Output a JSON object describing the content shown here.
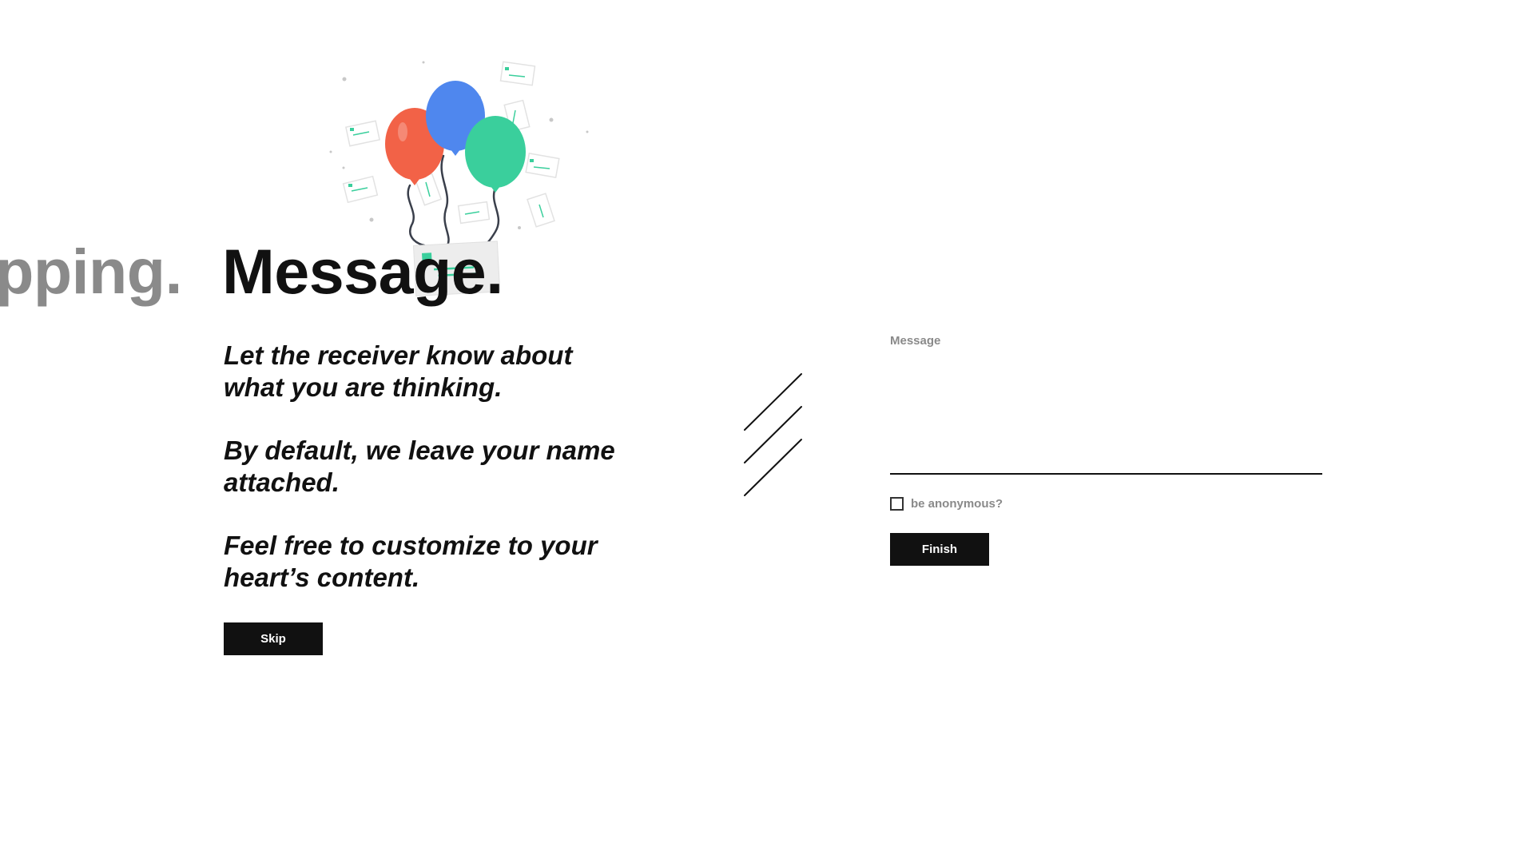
{
  "previous_step": {
    "title": "hipping."
  },
  "page": {
    "title": "Message."
  },
  "intro": {
    "paragraphs": [
      "Let the receiver know about what you are thinking.",
      "By default, we leave your name attached.",
      "Feel free to customize to your heart’s content."
    ]
  },
  "actions": {
    "skip_label": "Skip",
    "finish_label": "Finish"
  },
  "form": {
    "message_label": "Message",
    "message_value": "",
    "anonymous_label": "be anonymous?",
    "anonymous_checked": false
  },
  "illustration": {
    "name": "balloons-letters-illustration",
    "colors": {
      "balloon_red": "#f26247",
      "balloon_blue": "#4f87ee",
      "balloon_green": "#3acf9c",
      "accent": "#3acf9c"
    }
  },
  "colors": {
    "text": "#111111",
    "muted": "#8a8a8a",
    "button_bg": "#111111",
    "button_text": "#ffffff",
    "background": "#ffffff"
  }
}
